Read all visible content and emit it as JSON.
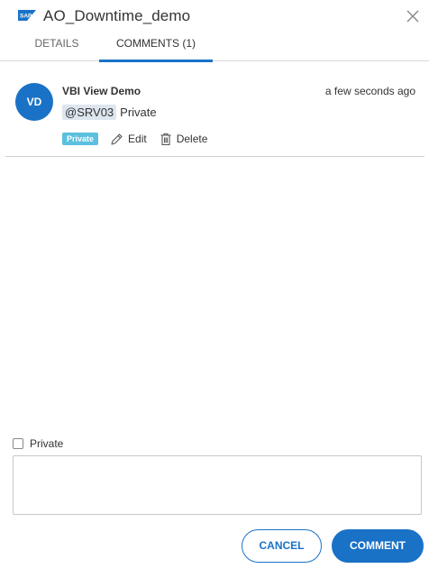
{
  "header": {
    "logo_text": "SAP",
    "title": "AO_Downtime_demo"
  },
  "tabs": [
    {
      "label": "DETAILS",
      "active": false
    },
    {
      "label": "COMMENTS (1)",
      "active": true
    }
  ],
  "comments": [
    {
      "avatar_initials": "VD",
      "author": "VBI View Demo",
      "time": "a few seconds ago",
      "mention": "@SRV03",
      "text": "Private",
      "badge": "Private",
      "edit_label": "Edit",
      "delete_label": "Delete"
    }
  ],
  "composer": {
    "private_label": "Private",
    "private_checked": false,
    "placeholder": ""
  },
  "buttons": {
    "cancel_label": "CANCEL",
    "comment_label": "COMMENT"
  },
  "colors": {
    "accent": "#1a72c7",
    "badge": "#5bc0de",
    "mention_bg": "#dde6ee"
  },
  "icons": {
    "logo": "sap-logo",
    "close": "close-icon",
    "edit": "pencil-icon",
    "delete": "trash-icon"
  }
}
